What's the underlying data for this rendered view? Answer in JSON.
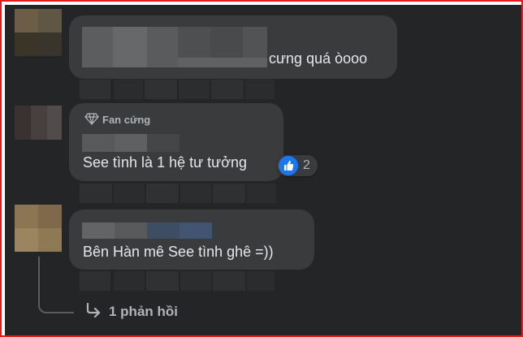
{
  "comments": [
    {
      "text": "cưng quá òooo"
    },
    {
      "badge": "Fan cứng",
      "text": "See tình là 1 hệ tư tưởng",
      "reaction_count": "2"
    },
    {
      "text": "Bên Hàn mê See tình ghê =))"
    }
  ],
  "reply_link": "1 phản hồi",
  "icons": {
    "badge_icon": "diamond-icon",
    "reaction_icon": "thumbs-up-icon",
    "reply_icon": "reply-arrow-icon"
  },
  "colors": {
    "background": "#242526",
    "bubble": "#3a3b3c",
    "text": "#e4e6eb",
    "muted": "#b0b3b8",
    "like": "#1877f2",
    "frame": "#e21b1b"
  }
}
